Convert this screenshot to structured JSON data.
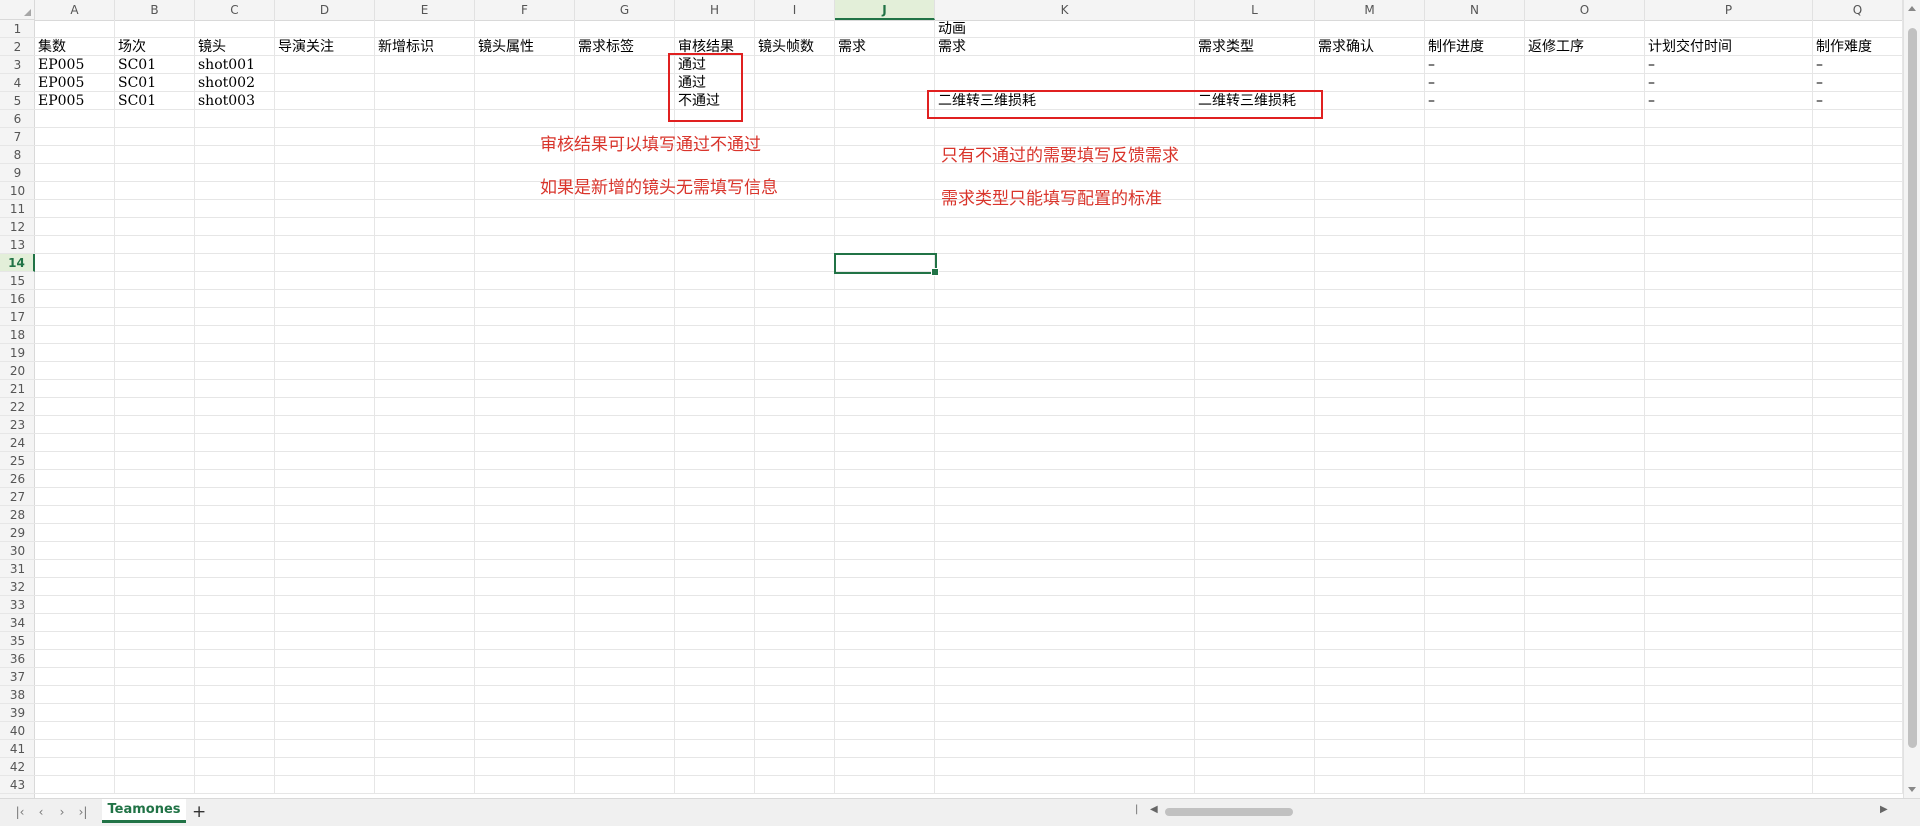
{
  "columns": [
    "A",
    "B",
    "C",
    "D",
    "E",
    "F",
    "G",
    "H",
    "I",
    "J",
    "K",
    "L",
    "M",
    "N",
    "O",
    "P",
    "Q"
  ],
  "active_column": "J",
  "rows": [
    "1",
    "2",
    "3",
    "4",
    "5",
    "6",
    "7",
    "8",
    "9",
    "10",
    "11",
    "12",
    "13",
    "14",
    "15",
    "16",
    "17",
    "18",
    "19",
    "20",
    "21",
    "22",
    "23",
    "24",
    "25",
    "26",
    "27",
    "28",
    "29",
    "30",
    "31",
    "32",
    "33",
    "34",
    "35",
    "36",
    "37",
    "38",
    "39",
    "40",
    "41",
    "42",
    "43"
  ],
  "active_row": "14",
  "header_row1": {
    "K": "动画"
  },
  "header_row2": {
    "A": "集数",
    "B": "场次",
    "C": "镜头",
    "D": "导演关注",
    "E": "新增标识",
    "F": "镜头属性",
    "G": "需求标签",
    "H": "审核结果",
    "I": "镜头帧数",
    "J": "需求",
    "K": "需求",
    "L": "需求类型",
    "M": "需求确认",
    "N": "制作进度",
    "O": "返修工序",
    "P": "计划交付时间",
    "Q": "制作难度"
  },
  "data_rows": [
    {
      "A": "EP005",
      "B": "SC01",
      "C": "shot001",
      "H": "通过",
      "N": "–",
      "P": "–",
      "Q": "–"
    },
    {
      "A": "EP005",
      "B": "SC01",
      "C": "shot002",
      "H": "通过",
      "N": "–",
      "P": "–",
      "Q": "–"
    },
    {
      "A": "EP005",
      "B": "SC01",
      "C": "shot003",
      "H": "不通过",
      "K": "二维转三维损耗",
      "L": "二维转三维损耗",
      "N": "–",
      "P": "–",
      "Q": "–"
    }
  ],
  "notes": {
    "left_1": "审核结果可以填写通过不通过",
    "left_2": "如果是新增的镜头无需填写信息",
    "right_1": "只有不通过的需要填写反馈需求",
    "right_2": "需求类型只能填写配置的标准"
  },
  "sheet_tabs": [
    "Teamones"
  ],
  "active_sheet": "Teamones",
  "colors": {
    "annotation_red": "#e02020",
    "accent_green": "#217346"
  },
  "icons": {
    "first_sheet": "first-sheet-icon",
    "prev_sheet": "prev-sheet-icon",
    "next_sheet": "next-sheet-icon",
    "last_sheet": "last-sheet-icon",
    "add_sheet": "add-sheet-icon"
  }
}
